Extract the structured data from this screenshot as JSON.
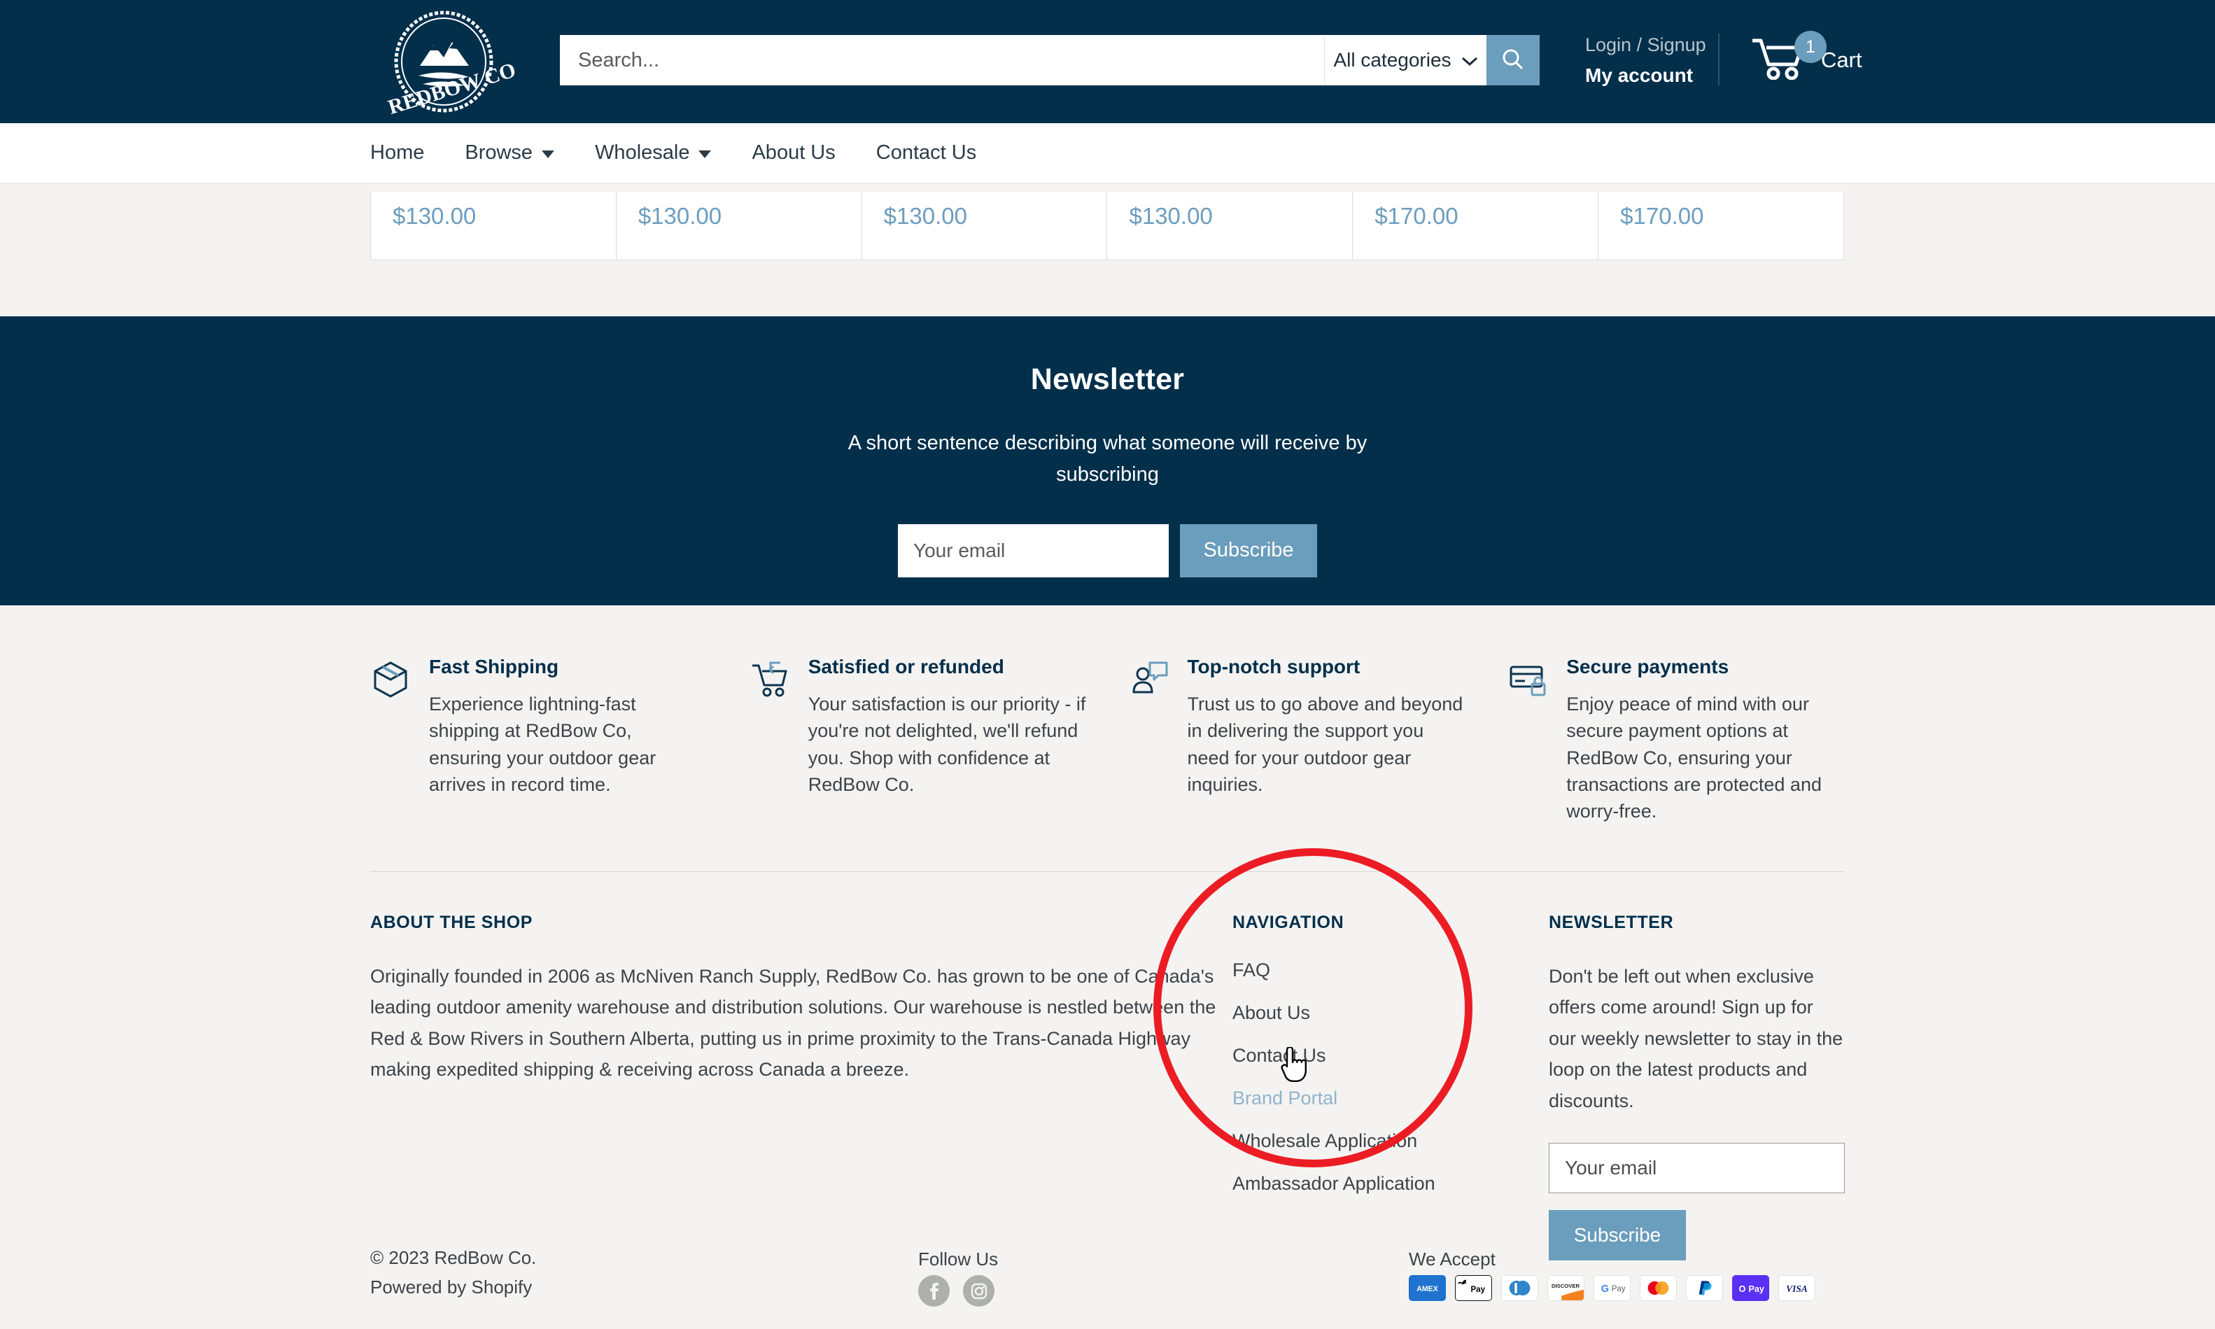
{
  "brand": {
    "logo_text": "REDBOW CO"
  },
  "colors": {
    "navy": "#032F4B",
    "page_bg": "#F4F3F1",
    "accent_blue": "#6B9DBC",
    "price_blue": "#6C9DBE",
    "annotation_red": "#EC1C24",
    "link_hover": "#8FB4CC"
  },
  "header": {
    "search": {
      "placeholder": "Search...",
      "value": ""
    },
    "category_select": {
      "selected": "All categories"
    },
    "search_button": "Search",
    "account": {
      "login_signup": "Login / Signup",
      "my_account": "My account"
    },
    "cart": {
      "label": "Cart",
      "count": "1"
    }
  },
  "nav": {
    "items": [
      {
        "label": "Home",
        "has_dropdown": false
      },
      {
        "label": "Browse",
        "has_dropdown": true
      },
      {
        "label": "Wholesale",
        "has_dropdown": true
      },
      {
        "label": "About Us",
        "has_dropdown": false
      },
      {
        "label": "Contact Us",
        "has_dropdown": false
      }
    ]
  },
  "product_row": {
    "prices": [
      "$130.00",
      "$130.00",
      "$130.00",
      "$130.00",
      "$170.00",
      "$170.00"
    ]
  },
  "newsletter_band": {
    "title": "Newsletter",
    "subtitle": "A short sentence describing what someone will receive by subscribing",
    "email_placeholder": "Your email",
    "subscribe_label": "Subscribe"
  },
  "features": [
    {
      "icon": "box-icon",
      "title": "Fast Shipping",
      "body": "Experience lightning-fast shipping at RedBow Co, ensuring your outdoor gear arrives in record time."
    },
    {
      "icon": "cart-return-icon",
      "title": "Satisfied or refunded",
      "body": "Your satisfaction is our priority - if you're not delighted, we'll refund you. Shop with confidence at RedBow Co."
    },
    {
      "icon": "support-person-icon",
      "title": "Top-notch support",
      "body": "Trust us to go above and beyond in delivering the support you need for your outdoor gear inquiries."
    },
    {
      "icon": "card-lock-icon",
      "title": "Secure payments",
      "body": "Enjoy peace of mind with our secure payment options at RedBow Co, ensuring your transactions are protected and worry-free."
    }
  ],
  "footer": {
    "about": {
      "heading": "ABOUT THE SHOP",
      "body": "Originally founded in 2006 as McNiven Ranch Supply, RedBow Co. has grown to be one of Canada's leading outdoor amenity warehouse and distribution solutions. Our warehouse is nestled between the Red & Bow Rivers in Southern Alberta, putting us in prime proximity to the Trans-Canada Highway making expedited shipping & receiving across Canada a breeze."
    },
    "navigation": {
      "heading": "NAVIGATION",
      "links": [
        {
          "label": "FAQ",
          "hover": false
        },
        {
          "label": "About Us",
          "hover": false
        },
        {
          "label": "Contact Us",
          "hover": false
        },
        {
          "label": "Brand Portal",
          "hover": true
        },
        {
          "label": "Wholesale Application",
          "hover": false
        },
        {
          "label": "Ambassador Application",
          "hover": false
        }
      ]
    },
    "newsletter": {
      "heading": "NEWSLETTER",
      "body": "Don't be left out when exclusive offers come around! Sign up for our weekly newsletter to stay in the loop on the latest products and discounts.",
      "email_placeholder": "Your email",
      "subscribe_label": "Subscribe"
    }
  },
  "bottom_bar": {
    "copyright": "© 2023 RedBow Co.",
    "powered_by": "Powered by Shopify",
    "follow_label": "Follow Us",
    "socials": [
      {
        "name": "facebook-icon"
      },
      {
        "name": "instagram-icon"
      }
    ],
    "accept_label": "We Accept",
    "payments": [
      {
        "name": "amex",
        "label": "AMEX"
      },
      {
        "name": "apple-pay",
        "label": "Pay"
      },
      {
        "name": "diners-club",
        "label": "Diners"
      },
      {
        "name": "discover",
        "label": "DISCOVER"
      },
      {
        "name": "google-pay",
        "label": "G Pay"
      },
      {
        "name": "mastercard",
        "label": "Mastercard"
      },
      {
        "name": "paypal",
        "label": "PayPal"
      },
      {
        "name": "shop-pay",
        "label": "Pay"
      },
      {
        "name": "visa",
        "label": "VISA"
      }
    ]
  },
  "annotation": {
    "type": "red-circle-highlight",
    "target": "Brand Portal",
    "cursor": "pointing-hand"
  }
}
